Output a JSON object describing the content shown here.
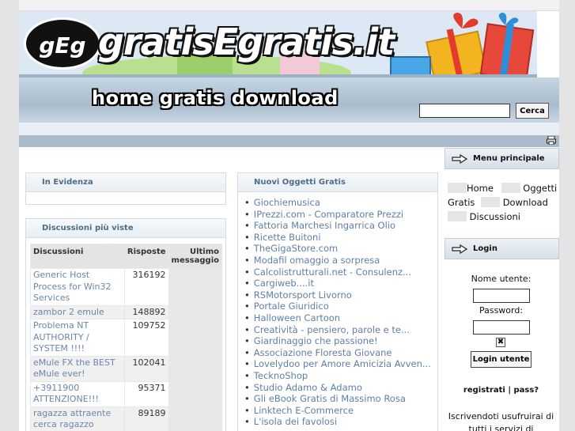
{
  "site": {
    "logo_badge": "gEg",
    "logo_text": "gratisEgratis.it",
    "nav_title": "home gratis download"
  },
  "search": {
    "value": "",
    "button_label": "Cerca"
  },
  "in_evidenza": {
    "title": "In Evidenza"
  },
  "discussioni": {
    "title": "Discussioni più viste",
    "columns": [
      "Discussioni",
      "Risposte",
      "Ultimo messaggio"
    ],
    "rows": [
      {
        "title": "Generic Host Process for Win32 Services",
        "replies": "316192"
      },
      {
        "title": "zambor 2 emule",
        "replies": "148892"
      },
      {
        "title": "Problema NT AUTHORITY / SYSTEM !!!!",
        "replies": "109752"
      },
      {
        "title": "eMule FX the BEST eMule ever!",
        "replies": "102041"
      },
      {
        "title": "+3911900 ATTENZIONE!!!",
        "replies": "95371"
      },
      {
        "title": "ragazza attraente cerca ragazzo",
        "replies": "89189"
      }
    ]
  },
  "nuovi_oggetti": {
    "title": "Nuovi Oggetti Gratis",
    "items": [
      "Giochiemusica",
      "IPrezzi.com - Comparatore Prezzi",
      "Fattoria Marchesi Ingarrica Olio",
      "Ricette Buitoni",
      "TheGigaStore.com",
      "Modafil omaggio a sorpresa",
      "Calcolistrutturali.net - Consulenz...",
      "Cargiweb....it",
      "RSMotorsport Livorno",
      "Portale Giuridico",
      "Halloween Cartoon",
      "Creatività - pensiero, parole e te...",
      "Giardinaggio che passione!",
      "Associazione Floresta Giovane",
      "Lovelydoo per Amore Amicizia Avven...",
      "TecknoShop",
      "Studio Adamo & Adamo",
      "Gli eBook Gratis di Massimo Rosa",
      "Linktech E-Commerce",
      "L'isola dei favolosi"
    ]
  },
  "menu": {
    "title": "Menu principale",
    "items": [
      "Home",
      "Oggetti Gratis",
      "Download",
      "Discussioni"
    ]
  },
  "login": {
    "title": "Login",
    "username_label": "Nome utente:",
    "password_label": "Password:",
    "remember_mark": "✖",
    "button_label": "Login utente",
    "register_link": "registrati | pass?",
    "info_text": "Iscrivendoti usufruirai di tutti i servizi di"
  },
  "colors": {
    "link": "#6c86a8",
    "header_text": "#4d6c8a",
    "band_dark": "#a9bbcb"
  },
  "icons": [
    "printer-icon",
    "arrow-right-icon"
  ]
}
